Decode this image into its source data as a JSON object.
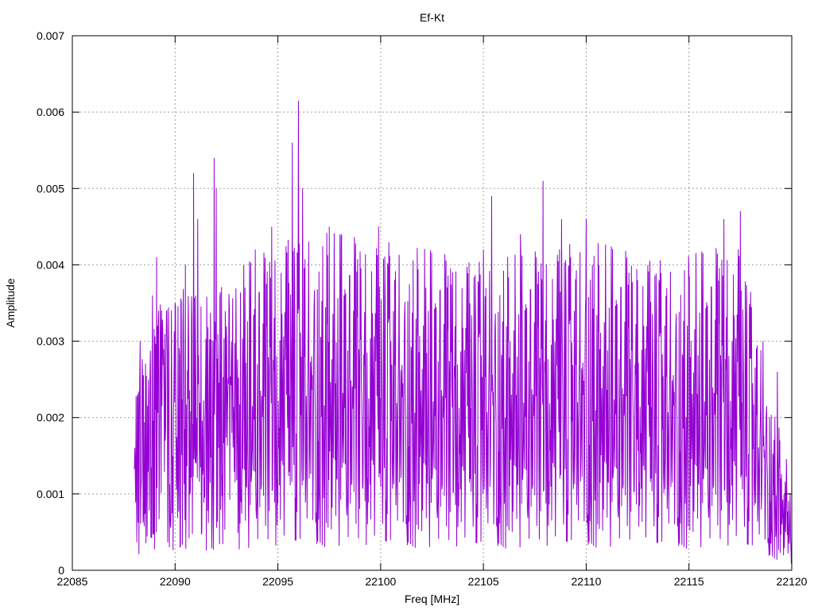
{
  "chart_data": {
    "type": "line",
    "title": "Ef-Kt",
    "xlabel": "Freq [MHz]",
    "ylabel": "Amplitude",
    "xlim": [
      22085,
      22120
    ],
    "ylim": [
      0,
      0.007
    ],
    "xticks": [
      "22085",
      "22090",
      "22095",
      "22100",
      "22105",
      "22110",
      "22115",
      "22120"
    ],
    "yticks": [
      "0",
      "0.001",
      "0.002",
      "0.003",
      "0.004",
      "0.005",
      "0.006",
      "0.007"
    ],
    "grid": true,
    "legend": "none",
    "series": [
      {
        "color": "#9400d3",
        "x_start": 22088,
        "x_end": 22120,
        "x_step": 0.02,
        "peaks": [
          {
            "x": 22088.3,
            "y": 0.003
          },
          {
            "x": 22088.9,
            "y": 0.0036
          },
          {
            "x": 22089.1,
            "y": 0.0041
          },
          {
            "x": 22089.4,
            "y": 0.0031
          },
          {
            "x": 22090.0,
            "y": 0.0035
          },
          {
            "x": 22090.5,
            "y": 0.004
          },
          {
            "x": 22090.9,
            "y": 0.0052
          },
          {
            "x": 22091.1,
            "y": 0.0046
          },
          {
            "x": 22091.9,
            "y": 0.0054
          },
          {
            "x": 22092.0,
            "y": 0.005
          },
          {
            "x": 22093.4,
            "y": 0.0037
          },
          {
            "x": 22093.9,
            "y": 0.0042
          },
          {
            "x": 22094.7,
            "y": 0.0045
          },
          {
            "x": 22095.7,
            "y": 0.0056
          },
          {
            "x": 22096.0,
            "y": 0.00615
          },
          {
            "x": 22096.2,
            "y": 0.005
          },
          {
            "x": 22097.5,
            "y": 0.0045
          },
          {
            "x": 22098.1,
            "y": 0.0044
          },
          {
            "x": 22099.9,
            "y": 0.0045
          },
          {
            "x": 22102.2,
            "y": 0.0037
          },
          {
            "x": 22103.5,
            "y": 0.0039
          },
          {
            "x": 22105.0,
            "y": 0.0042
          },
          {
            "x": 22105.4,
            "y": 0.0049
          },
          {
            "x": 22106.8,
            "y": 0.0044
          },
          {
            "x": 22107.9,
            "y": 0.0051
          },
          {
            "x": 22108.8,
            "y": 0.0046
          },
          {
            "x": 22110.0,
            "y": 0.0046
          },
          {
            "x": 22110.3,
            "y": 0.004
          },
          {
            "x": 22112.5,
            "y": 0.0038
          },
          {
            "x": 22115.0,
            "y": 0.0038
          },
          {
            "x": 22116.7,
            "y": 0.0046
          },
          {
            "x": 22117.5,
            "y": 0.0047
          },
          {
            "x": 22118.6,
            "y": 0.003
          },
          {
            "x": 22119.3,
            "y": 0.0026
          }
        ],
        "envelope": [
          {
            "x": 22088.0,
            "y": 0.0016
          },
          {
            "x": 22089.0,
            "y": 0.0025
          },
          {
            "x": 22092.0,
            "y": 0.0026
          },
          {
            "x": 22096.0,
            "y": 0.0031
          },
          {
            "x": 22100.0,
            "y": 0.003
          },
          {
            "x": 22105.0,
            "y": 0.0028
          },
          {
            "x": 22110.0,
            "y": 0.003
          },
          {
            "x": 22114.0,
            "y": 0.0028
          },
          {
            "x": 22117.5,
            "y": 0.003
          },
          {
            "x": 22119.0,
            "y": 0.0016
          },
          {
            "x": 22120.0,
            "y": 0.0008
          }
        ]
      }
    ]
  }
}
